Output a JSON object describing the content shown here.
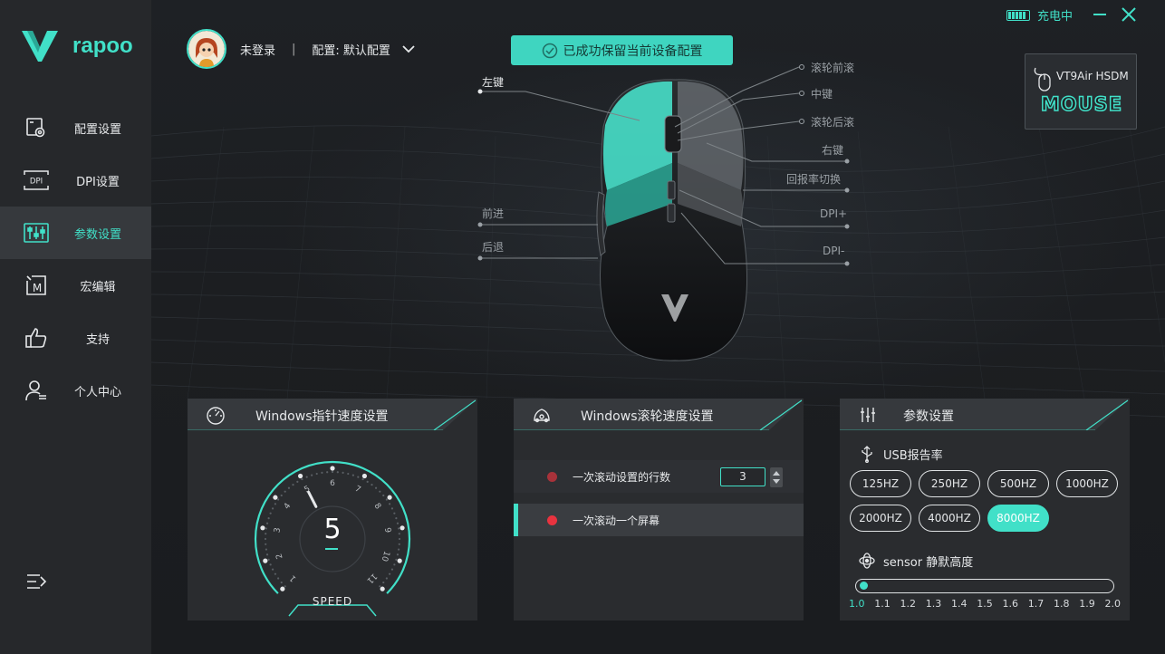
{
  "app": {
    "brand": "rapoo",
    "accent": "#41e0c8"
  },
  "sidebar": {
    "items": [
      {
        "label": "配置设置",
        "icon": "config-icon",
        "active": false
      },
      {
        "label": "DPI设置",
        "icon": "dpi-icon",
        "active": false
      },
      {
        "label": "参数设置",
        "icon": "parameters-icon",
        "active": true
      },
      {
        "label": "宏编辑",
        "icon": "macro-icon",
        "active": false
      },
      {
        "label": "支持",
        "icon": "thumbs-up-icon",
        "active": false
      },
      {
        "label": "个人中心",
        "icon": "user-icon",
        "active": false
      }
    ]
  },
  "topbar": {
    "charging": "充电中"
  },
  "user": {
    "name": "未登录",
    "separator": "|",
    "config": "配置: 默认配置"
  },
  "toast": {
    "message": "已成功保留当前设备配置"
  },
  "device": {
    "model": "VT9Air HSDM",
    "type": "MOUSE"
  },
  "mouse_labels": {
    "left_button": "左键",
    "forward": "前进",
    "back": "后退",
    "scroll_forward": "滚轮前滚",
    "middle": "中键",
    "scroll_back": "滚轮后滚",
    "right_button": "右键",
    "report_rate_switch": "回报率切换",
    "dpi_plus": "DPI+",
    "dpi_minus": "DPI-"
  },
  "pointer_panel": {
    "title": "Windows指针速度设置",
    "value": "5",
    "caption": "SPEED",
    "scale": [
      "1",
      "2",
      "3",
      "4",
      "5",
      "6",
      "7",
      "8",
      "9",
      "10",
      "11"
    ]
  },
  "scroll_panel": {
    "title": "Windows滚轮速度设置",
    "option_lines": "一次滚动设置的行数",
    "lines_value": "3",
    "option_screen": "一次滚动一个屏幕",
    "selected": "一次滚动一个屏幕"
  },
  "params_panel": {
    "title": "参数设置",
    "usb_label": "USB报告率",
    "rates": [
      "125HZ",
      "250HZ",
      "500HZ",
      "1000HZ",
      "2000HZ",
      "4000HZ",
      "8000HZ"
    ],
    "selected_rate": "8000HZ",
    "sensor_label": "sensor 静默高度",
    "heights": [
      "1.0",
      "1.1",
      "1.2",
      "1.3",
      "1.4",
      "1.5",
      "1.6",
      "1.7",
      "1.8",
      "1.9",
      "2.0"
    ],
    "selected_height": "1.0"
  }
}
